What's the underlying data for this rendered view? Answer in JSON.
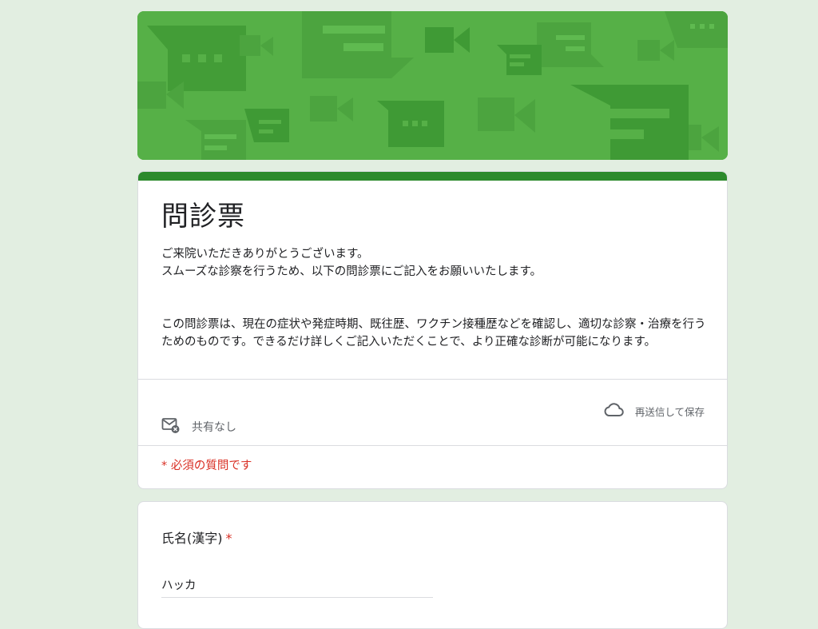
{
  "form": {
    "title": "問診票",
    "description_line1": "ご来院いただきありがとうございます。",
    "description_line2": "スムーズな診察を行うため、以下の問診票にご記入をお願いいたします。",
    "description_para2": "この問診票は、現在の症状や発症時期、既往歴、ワクチン接種歴などを確認し、適切な診察・治療を行うためのものです。できるだけ詳しくご記入いただくことで、より正確な診断が可能になります。",
    "email_status": "共有なし",
    "save_status": "再送信して保存",
    "required_note": "* 必須の質問です"
  },
  "question1": {
    "label": "氏名(漢字)",
    "required_mark": "*",
    "value": "ハッカ"
  },
  "colors": {
    "page_bg": "#e2eee1",
    "banner": "#54ae45",
    "accent": "#2c8a2c",
    "required": "#d93025"
  },
  "icons": {
    "email": "mail-blocked-icon",
    "cloud": "cloud-icon"
  }
}
